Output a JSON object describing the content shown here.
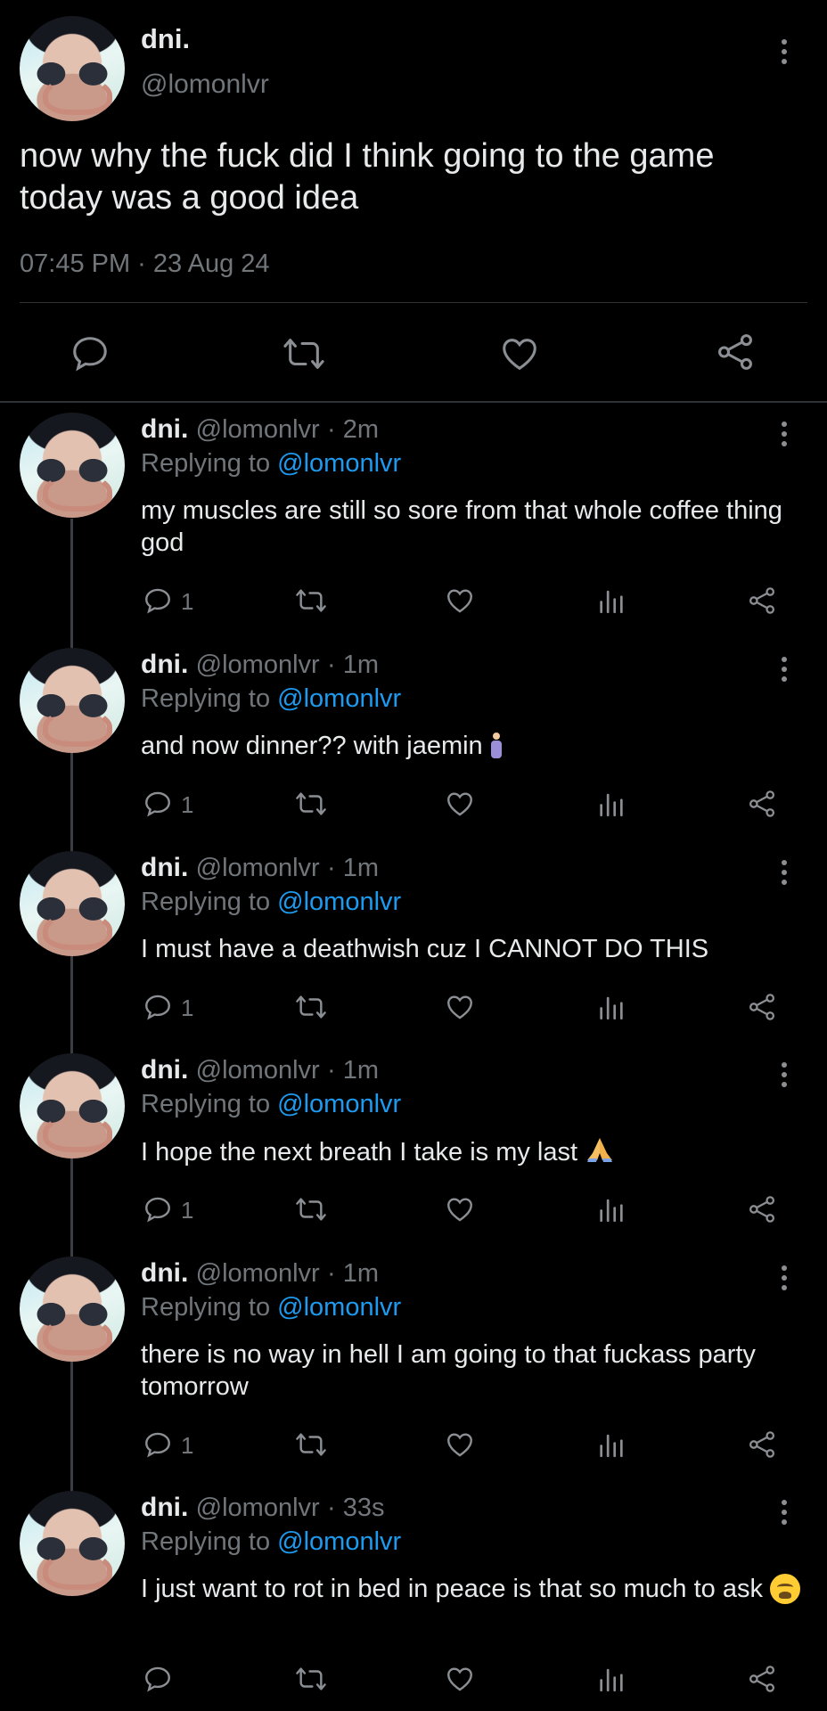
{
  "main_tweet": {
    "display_name": "dni.",
    "handle": "@lomonlvr",
    "text": "now why the fuck did I think going to the game today was a good idea",
    "timestamp": "07:45 PM · 23 Aug 24"
  },
  "replies": [
    {
      "display_name": "dni.",
      "handle": "@lomonlvr",
      "time": "· 2m",
      "replying_label": "Replying to",
      "mention": "@lomonlvr",
      "text": "my muscles are still so sore from that whole coffee thing god",
      "reply_count": "1"
    },
    {
      "display_name": "dni.",
      "handle": "@lomonlvr",
      "time": "· 1m",
      "replying_label": "Replying to",
      "mention": "@lomonlvr",
      "text": "and now dinner?? with jaemin",
      "emoji": "person-standing-emoji",
      "reply_count": "1"
    },
    {
      "display_name": "dni.",
      "handle": "@lomonlvr",
      "time": "· 1m",
      "replying_label": "Replying to",
      "mention": "@lomonlvr",
      "text": "I must have a deathwish cuz I CANNOT DO THIS",
      "reply_count": "1"
    },
    {
      "display_name": "dni.",
      "handle": "@lomonlvr",
      "time": "· 1m",
      "replying_label": "Replying to",
      "mention": "@lomonlvr",
      "text": "I hope the next breath I take is my last",
      "emoji": "folded-hands-emoji",
      "reply_count": "1"
    },
    {
      "display_name": "dni.",
      "handle": "@lomonlvr",
      "time": "· 1m",
      "replying_label": "Replying to",
      "mention": "@lomonlvr",
      "text": "there is no way in hell I am going to that fuckass party tomorrow",
      "reply_count": "1"
    },
    {
      "display_name": "dni.",
      "handle": "@lomonlvr",
      "time": "· 33s",
      "replying_label": "Replying to",
      "mention": "@lomonlvr",
      "text": "I just want to rot in bed in peace is that so much to ask",
      "emoji": "weary-face-emoji",
      "reply_count": ""
    }
  ],
  "icons": [
    "comment-icon",
    "retweet-icon",
    "like-icon",
    "views-icon",
    "share-icon",
    "more-options-icon"
  ],
  "colors": {
    "background": "#000000",
    "text": "#e7e9ea",
    "muted": "#71767b",
    "link": "#1d9bf0",
    "divider": "#2f3336"
  }
}
